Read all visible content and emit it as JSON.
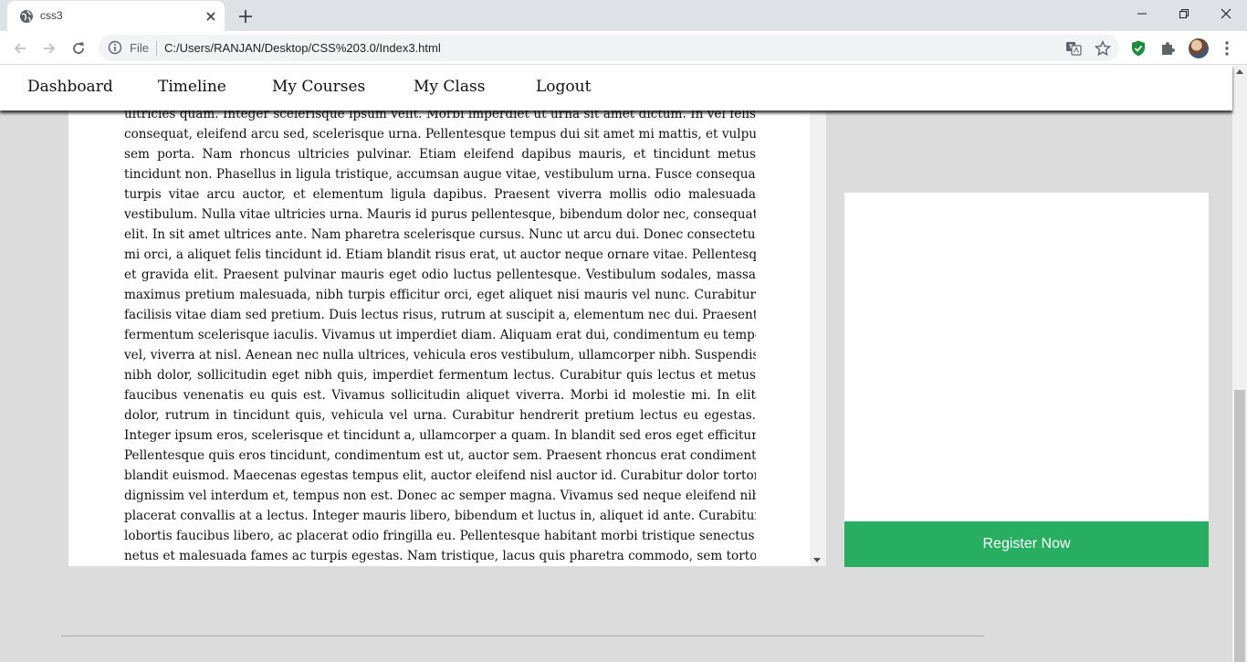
{
  "browser": {
    "tab_title": "css3",
    "omnibox": {
      "scheme_label": "File",
      "url": "C:/Users/RANJAN/Desktop/CSS%203.0/Index3.html"
    },
    "icons": [
      "globe-icon",
      "close-icon",
      "plus-icon",
      "minimize-icon",
      "restore-icon",
      "back-icon",
      "forward-icon",
      "reload-icon",
      "info-icon",
      "translate-icon",
      "star-icon",
      "shield-extension-icon",
      "puzzle-icon",
      "avatar",
      "menu-dots-icon"
    ]
  },
  "site_nav": {
    "items": [
      {
        "label": "Dashboard"
      },
      {
        "label": "Timeline"
      },
      {
        "label": "My Courses"
      },
      {
        "label": "My Class"
      },
      {
        "label": "Logout"
      }
    ]
  },
  "article": {
    "lines": [
      "ultricies quam. Integer scelerisque ipsum velit. Morbi imperdiet ut urna sit amet dictum. In vel felis",
      "consequat, eleifend arcu sed, scelerisque urna. Pellentesque tempus dui sit amet mi mattis, et vulputate",
      "sem porta. Nam rhoncus ultricies pulvinar. Etiam eleifend dapibus mauris, et tincidunt metus",
      "tincidunt non. Phasellus in ligula tristique, accumsan augue vitae, vestibulum urna. Fusce consequat",
      "turpis vitae arcu auctor, et elementum ligula dapibus. Praesent viverra mollis odio malesuada",
      "vestibulum. Nulla vitae ultricies urna. Mauris id purus pellentesque, bibendum dolor nec, consequat",
      "elit. In sit amet ultrices ante. Nam pharetra scelerisque cursus. Nunc ut arcu dui. Donec consectetur",
      "mi orci, a aliquet felis tincidunt id. Etiam blandit risus erat, ut auctor neque ornare vitae. Pellentesque",
      "et gravida elit. Praesent pulvinar mauris eget odio luctus pellentesque. Vestibulum sodales, massa",
      "maximus pretium malesuada, nibh turpis efficitur orci, eget aliquet nisi mauris vel nunc. Curabitur",
      "facilisis vitae diam sed pretium. Duis lectus risus, rutrum at suscipit a, elementum nec dui. Praesent",
      "fermentum scelerisque iaculis. Vivamus ut imperdiet diam. Aliquam erat dui, condimentum eu tempor",
      "vel, viverra at nisl. Aenean nec nulla ultrices, vehicula eros vestibulum, ullamcorper nibh. Suspendisse",
      "nibh dolor, sollicitudin eget nibh quis, imperdiet fermentum lectus. Curabitur quis lectus et metus",
      "faucibus venenatis eu quis est. Vivamus sollicitudin aliquet viverra. Morbi id molestie mi. In elit",
      "dolor, rutrum in tincidunt quis, vehicula vel urna. Curabitur hendrerit pretium lectus eu egestas.",
      "Integer ipsum eros, scelerisque et tincidunt a, ullamcorper a quam. In blandit sed eros eget efficitur.",
      "Pellentesque quis eros tincidunt, condimentum est ut, auctor sem. Praesent rhoncus erat condimentum",
      "blandit euismod. Maecenas egestas tempus elit, auctor eleifend nisl auctor id. Curabitur dolor tortor,",
      "dignissim vel interdum et, tempus non est. Donec ac semper magna. Vivamus sed neque eleifend nibh",
      "placerat convallis at a lectus. Integer mauris libero, bibendum et luctus in, aliquet id ante. Curabitur",
      "lobortis faucibus libero, ac placerat odio fringilla eu. Pellentesque habitant morbi tristique senectus et",
      "netus et malesuada fames ac turpis egestas. Nam tristique, lacus quis pharetra commodo, sem tortor"
    ]
  },
  "side_card": {
    "button_label": "Register Now"
  },
  "colors": {
    "register_button": "#27ae60",
    "page_background": "#dcdcdc"
  }
}
